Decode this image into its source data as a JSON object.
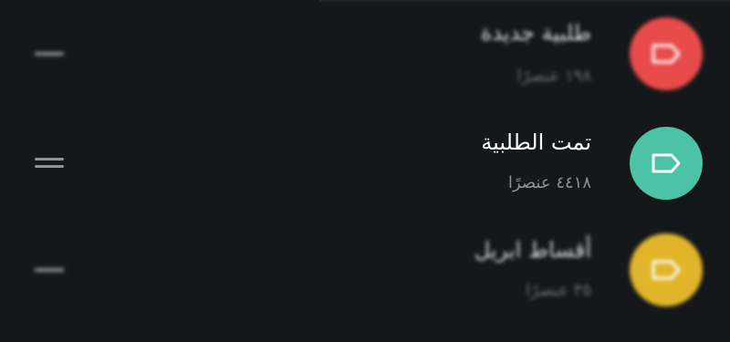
{
  "list": {
    "items": [
      {
        "title": "طلبية جديدة",
        "subtitle": "١٩٨ عنصرًا",
        "icon": "tag-icon",
        "color": "#e94b4b"
      },
      {
        "title": "تمت الطلبية",
        "subtitle": "٤٤١٨ عنصرًا",
        "icon": "tag-icon",
        "color": "#4cc2a6"
      },
      {
        "title": "أقساط ابريل",
        "subtitle": "٣٥ عنصرًا",
        "icon": "tag-icon",
        "color": "#e1b52a"
      }
    ]
  },
  "colors": {
    "background": "#15181b",
    "title_text": "#ffffff",
    "subtitle_text": "#8b9096",
    "handle": "#8f949a"
  },
  "icons": {
    "drag_handle": "drag-handle-icon"
  }
}
